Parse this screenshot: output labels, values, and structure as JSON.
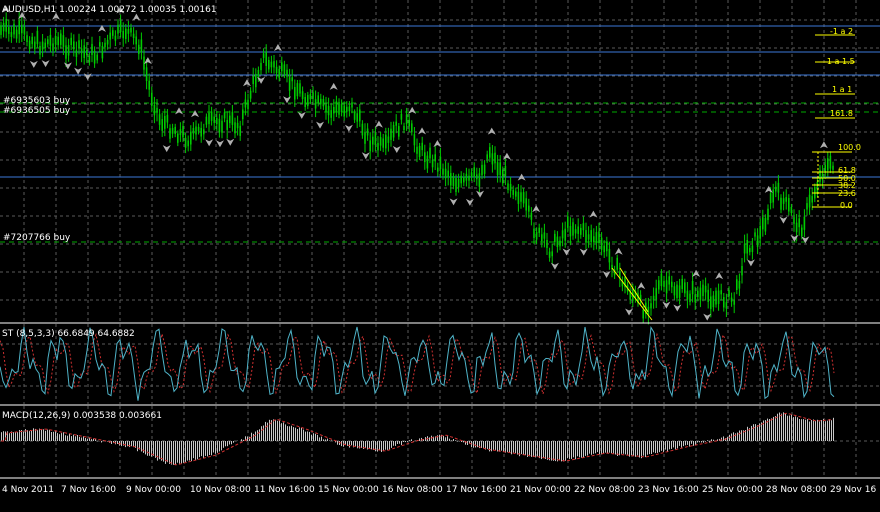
{
  "window": {
    "symbol_header": "AUDUSD,H1  1.00224 1.00272 1.00035 1.00161"
  },
  "main_chart": {
    "order_labels": [
      "#6935603 buy",
      "#6936505 buy",
      "#7207766 buy"
    ],
    "fib_expansion_labels": [
      "-1 a 2",
      "-1 a 1.5",
      "1 a 1",
      "161.8"
    ],
    "fib_retracement_labels": [
      "100.0",
      "61.8",
      "50.0",
      "38.2",
      "23.6",
      "0.0"
    ]
  },
  "stochastic": {
    "label": "ST (8,5,3,3) 66.6849 64.6882"
  },
  "macd": {
    "label": "MACD(12,26,9) 0.003538 0.003661"
  },
  "time_axis": {
    "labels": [
      "4 Nov 2011",
      "7 Nov 16:00",
      "9 Nov 00:00",
      "10 Nov 08:00",
      "11 Nov 16:00",
      "15 Nov 00:00",
      "16 Nov 08:00",
      "17 Nov 16:00",
      "21 Nov 00:00",
      "22 Nov 08:00",
      "23 Nov 16:00",
      "25 Nov 00:00",
      "28 Nov 08:00",
      "29 Nov 16"
    ]
  },
  "colors": {
    "background": "#000000",
    "grid": "#5a5a5a",
    "candles": "#00cc00",
    "fractal_arrows": "#b0b0b0",
    "order_lines": "#00aa00",
    "level_lines": "#3b78d8",
    "fib": "#ffff00",
    "stoch_main": "#4fb3c8",
    "stoch_signal": "#d03030",
    "macd_hist": "#c8c8c8",
    "macd_signal": "#d03030"
  }
}
